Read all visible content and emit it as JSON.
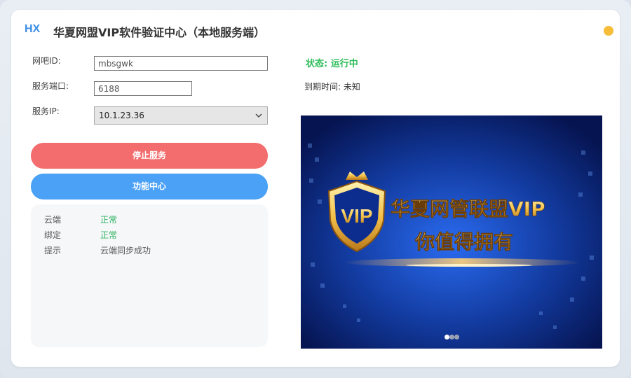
{
  "window": {
    "logo": "HX",
    "title": "华夏网盟VIP软件验证中心（本地服务端）",
    "status_dot_color": "#f7bd38"
  },
  "form": {
    "netcafe_label": "网吧ID:",
    "netcafe_value": "mbsgwk",
    "port_label": "服务端口:",
    "port_value": "6188",
    "ip_label": "服务IP:",
    "ip_value": "10.1.23.36"
  },
  "buttons": {
    "stop": "停止服务",
    "function_center": "功能中心"
  },
  "info_panel": {
    "rows": [
      {
        "key": "云端",
        "value": "正常"
      },
      {
        "key": "绑定",
        "value": "正常"
      },
      {
        "key": "提示",
        "value": "云端同步成功"
      }
    ]
  },
  "status": {
    "state": "状态: 运行中",
    "expire": "到期时间: 未知",
    "state_color": "#2ebd5a"
  },
  "banner": {
    "vip_badge": "VIP",
    "headline": "华夏网管联盟VIP",
    "subline": "你值得拥有",
    "slides": 3,
    "active_slide": 0
  },
  "colors": {
    "stop_button": "#f36d6e",
    "function_button": "#4aa1f6",
    "accent": "#3a8ee6"
  }
}
